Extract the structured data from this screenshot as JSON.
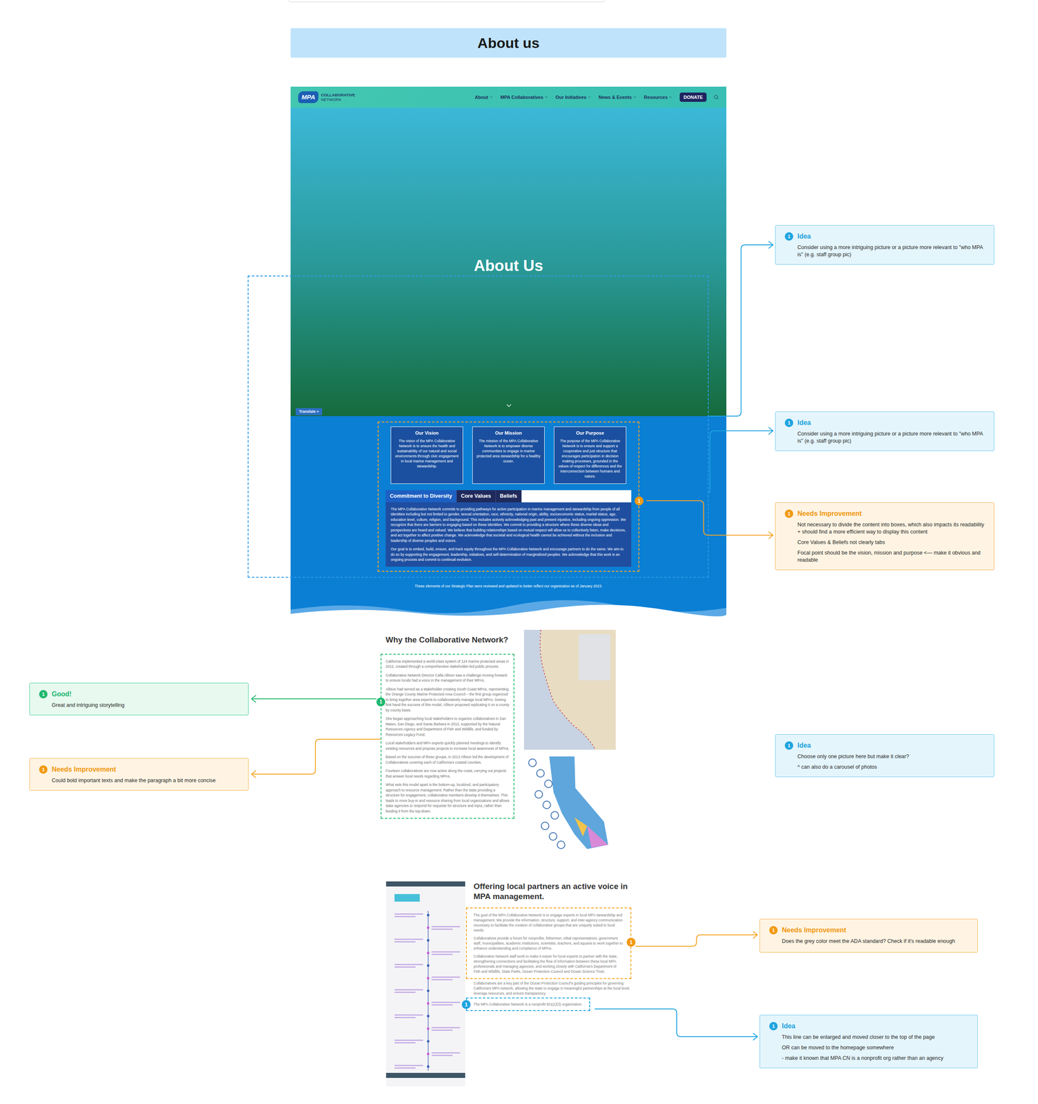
{
  "section_header": "About us",
  "site": {
    "nav": {
      "logo": {
        "mark": "MPA",
        "line1": "COLLABORATIVE",
        "line2": "NETWORK"
      },
      "items": [
        "About",
        "MPA Collaboratives",
        "Our Initiatives",
        "News & Events",
        "Resources"
      ],
      "donate": "DONATE"
    },
    "hero": {
      "title": "About Us",
      "translate": "Translate »"
    },
    "cards": [
      {
        "title": "Our Vision",
        "text": "The vision of the MPA Collaborative Network is to ensure the health and sustainability of our natural and social environments through civic engagement in local marine management and stewardship."
      },
      {
        "title": "Our Mission",
        "text": "The mission of the MPA Collaborative Network is to empower diverse communities to engage in marine protected area stewardship for a healthy ocean."
      },
      {
        "title": "Our Purpose",
        "text": "The purpose of the MPA Collaborative Network is to ensure and support a cooperative and just structure that encourages participation in decision making processes, grounded in the values of respect for differences and the interconnection between humans and nature."
      }
    ],
    "tabs": [
      {
        "label": "Commitment to Diversity",
        "selected": true
      },
      {
        "label": "Core Values",
        "selected": false
      },
      {
        "label": "Beliefs",
        "selected": false
      }
    ],
    "tab_content": [
      "The MPA Collaborative Network commits to providing pathways for active participation in marine management and stewardship from people of all identities including but not limited to gender, sexual orientation, race, ethnicity, national origin, ability, socioeconomic status, marital status, age, education level, culture, religion, and background. This includes actively acknowledging past and present injustice, including ongoing oppression. We recognize that there are barriers to engaging based on these identities. We commit to providing a structure where these diverse ideas and perspectives are heard and valued. We believe that building relationships based on mutual respect will allow us to collectively listen, make decisions, and act together to affect positive change. We acknowledge that societal and ecological health cannot be achieved without the inclusion and leadership of diverse peoples and voices.",
      "Our goal is to embed, build, ensure, and track equity throughout the MPA Collaborative Network and encourage partners to do the same. We aim to do so by supporting the engagement, leadership, initiatives, and self-determination of marginalized peoples. We acknowledge that this work is an ongoing process and commit to continual evolution."
    ],
    "footnote": "These elements of our Strategic Plan were reviewed and updated to better reflect our organization as of January 2023."
  },
  "why": {
    "heading": "Why the Collaborative Network?",
    "paragraphs": [
      "California implemented a world-class system of 124 marine protected areas in 2012, created through a comprehensive stakeholder-led public process.",
      "Collaborative Network Director Calla Allison saw a challenge moving forward: to ensure locals had a voice in the management of their MPAs.",
      "Allison had served as a stakeholder creating South Coast MPAs, representing the Orange County Marine Protected Area Council – the first group organized to bring together area experts to collaboratively manage local MPAs. Seeing first hand the success of this model, Allison proposed replicating it on a county by county basis.",
      "She began approaching local stakeholders to organize collaboratives in San Mateo, San Diego, and Santa Barbara in 2012, supported by the Natural Resources Agency and Department of Fish and Wildlife, and funded by Resources Legacy Fund.",
      "Local stakeholders and MPA experts quickly planned meetings to identify existing resources and propose projects to increase local awareness of MPAs.",
      "Based on the success of these groups, in 2013 Allison led the development of Collaboratives covering each of California's coastal counties.",
      "Fourteen collaboratives are now active along the coast, carrying out projects that answer local needs regarding MPAs.",
      "What sets this model apart is the bottom-up, localized, and participatory approach to resource management. Rather than the state providing a structure for engagement, collaborative members develop it themselves. This leads to more buy-in and resource sharing from local organizations and allows state agencies to respond for requests for structure and input, rather than feeding it from the top-down."
    ]
  },
  "offering": {
    "heading": "Offering local partners an active voice in MPA management.",
    "paragraphs": [
      "The goal of the MPA Collaborative Network is to engage experts in local MPA stewardship and management. We provide the information, structure, support, and inter-agency communication necessary to facilitate the creation of collaborative groups that are uniquely suited to local needs.",
      "Collaboratives provide a forum for nonprofits, fishermen, tribal representatives, government staff, municipalities, academic institutions, scientists, teachers, and aquaria to work together to enhance understanding and compliance of MPAs.",
      "Collaborative Network staff work to make it easier for local experts to partner with the state, strengthening connections and facilitating the flow of information between these local MPA professionals and managing agencies, and working closely with California's Department of Fish and Wildlife, State Parks, Ocean Protection Council and Ocean Science Trust."
    ],
    "extra_paragraph": "Collaboratives are a key part of the Ocean Protection Council's guiding principles for governing California's MPA network, allowing the state to engage in meaningful partnerships at the local level, leverage resources, and ensure transparency.",
    "nonprofit_line": "The MPA Collaborative Network is a nonprofit 501(c)(3) organization."
  },
  "pins": [
    {
      "label": "1",
      "kind": "needs"
    },
    {
      "label": "1",
      "kind": "good"
    },
    {
      "label": "1",
      "kind": "needs"
    },
    {
      "label": "1",
      "kind": "idea"
    }
  ],
  "annotations": [
    {
      "kind": "idea",
      "marker": "1",
      "title": "Idea",
      "lines": [
        "Consider using a more intriguing picture or a picture more relevant to \"who MPA is\" (e.g. staff group pic)"
      ]
    },
    {
      "kind": "idea",
      "marker": "1",
      "title": "Idea",
      "lines": [
        "Consider using a more intriguing picture or a picture more relevant to \"who MPA is\" (e.g. staff group pic)"
      ]
    },
    {
      "kind": "needs",
      "marker": "1",
      "title": "Needs Improvement",
      "lines": [
        "Not necessary to divide the content into boxes, which also impacts its readability + should find a more efficient way to display this content",
        "Core Values & Beliefs not clearly tabs",
        "Focal point should be the vision, mission and purpose <— make it obvious and readable"
      ]
    },
    {
      "kind": "good",
      "marker": "1",
      "title": "Good!",
      "lines": [
        "Great and intriguing storytelling"
      ]
    },
    {
      "kind": "needs",
      "marker": "1",
      "title": "Needs Improvement",
      "lines": [
        "Could bold important texts and make the paragraph a bit more concise"
      ]
    },
    {
      "kind": "idea",
      "marker": "1",
      "title": "Idea",
      "lines": [
        "Choose only one picture here but make it clear?",
        "^ can also do a carousel of photos"
      ]
    },
    {
      "kind": "needs",
      "marker": "1",
      "title": "Needs Improvement",
      "lines": [
        "Does the grey color meet the ADA standard? Check if it's readable enough"
      ]
    },
    {
      "kind": "idea",
      "marker": "1",
      "title": "Idea",
      "lines": [
        "This line can be enlarged and moved closer to the top of the page",
        "OR can be moved to the homepage somewhere",
        "-  make it known that MPA CN is a nonprofit org rather than an agency"
      ]
    }
  ]
}
